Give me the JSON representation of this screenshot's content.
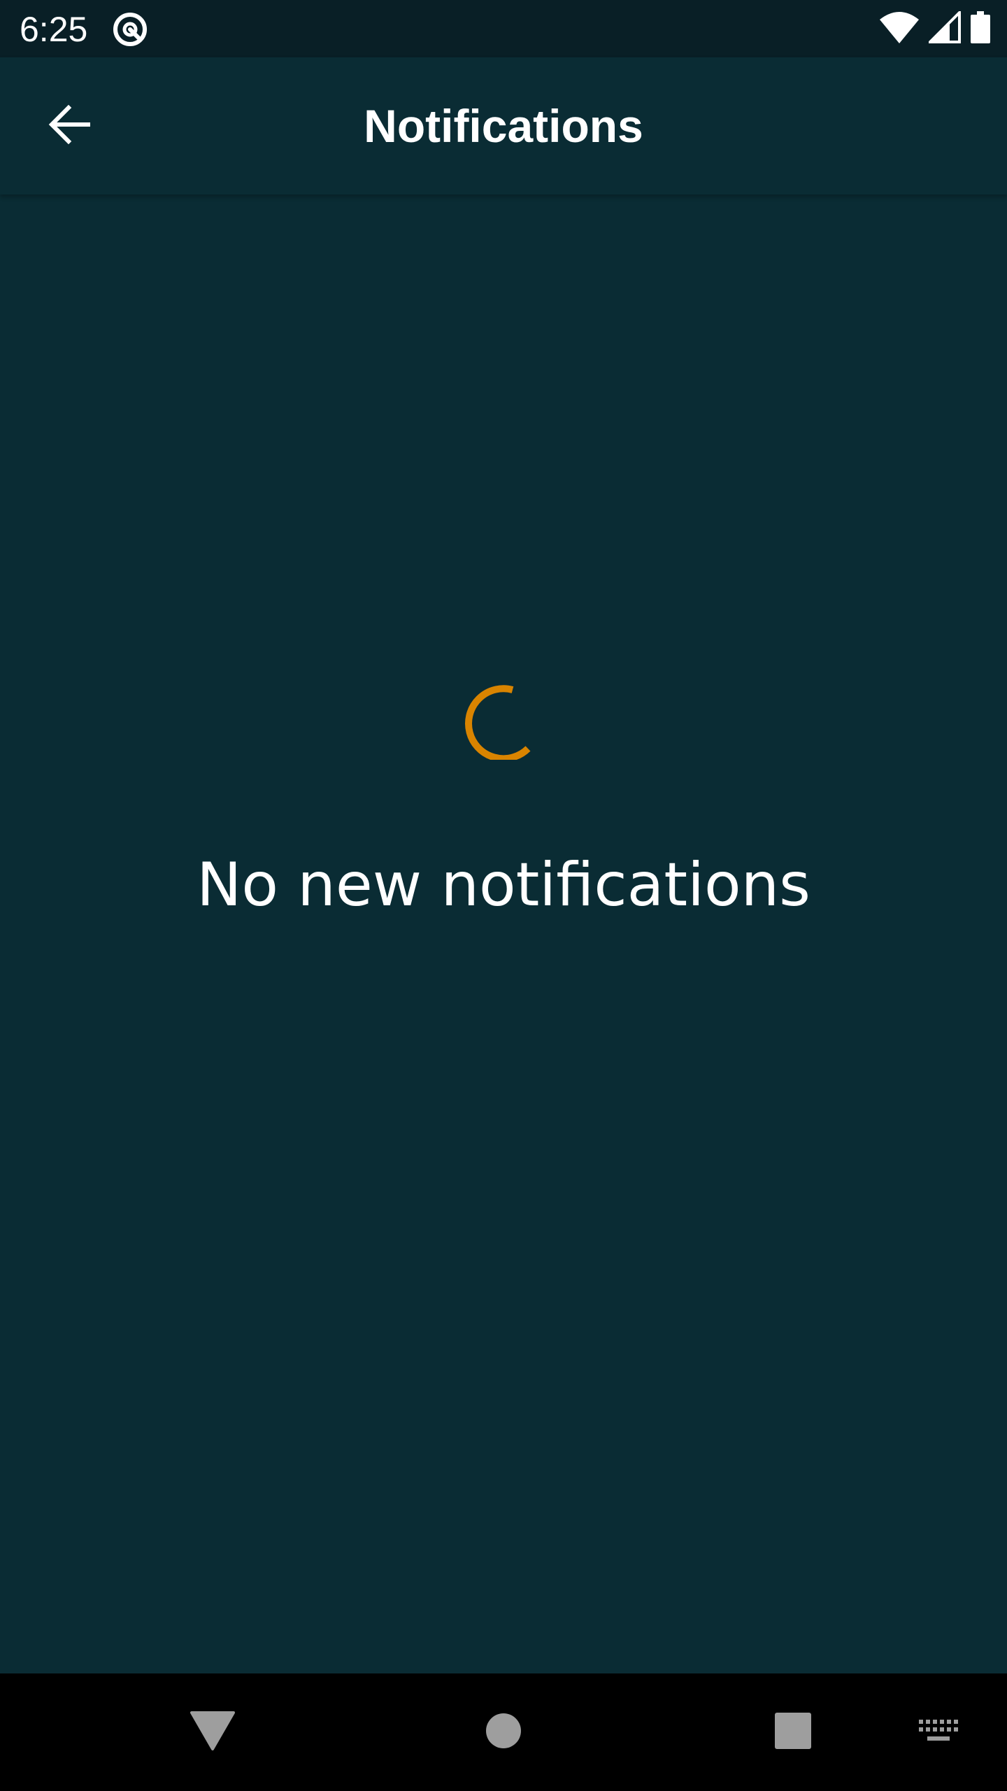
{
  "status_bar": {
    "time": "6:25",
    "app_icon": "at-sign-icon",
    "icons": [
      "wifi-icon",
      "cell-signal-icon",
      "battery-icon"
    ]
  },
  "app_bar": {
    "title": "Notifications",
    "back_icon": "arrow-back-icon"
  },
  "content": {
    "empty_message": "No new notifications",
    "spinner_icon": "loading-spinner-icon",
    "accent_color": "#d98400"
  },
  "nav_bar": {
    "icons": [
      "back-triangle-icon",
      "home-circle-icon",
      "recents-square-icon",
      "keyboard-icon"
    ]
  },
  "colors": {
    "background": "#0a2c34",
    "status_bar": "#091f26",
    "nav_bar": "#000000",
    "text": "#ffffff"
  }
}
